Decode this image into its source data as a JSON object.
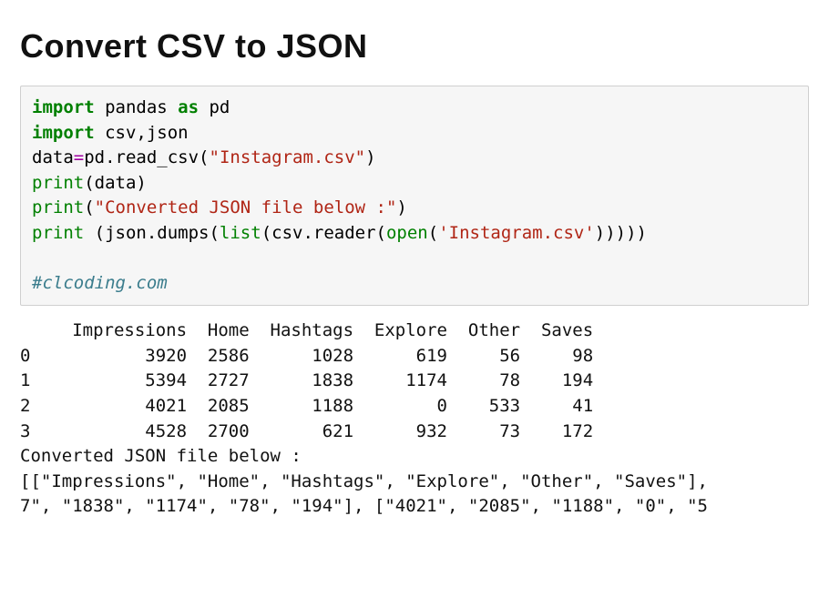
{
  "title": "Convert CSV to JSON",
  "code": {
    "line1": {
      "kw_import1": "import",
      "pandas": " pandas ",
      "kw_as": "as",
      "pd": " pd"
    },
    "line2": {
      "kw_import2": "import",
      "modules": " csv,json"
    },
    "line3": {
      "data": "data",
      "eq": "=",
      "pdread": "pd.read_csv(",
      "file": "\"Instagram.csv\"",
      "close": ")"
    },
    "line4": {
      "print": "print",
      "args": "(data)"
    },
    "line5": {
      "print": "print",
      "open": "(",
      "str": "\"Converted JSON file below :\"",
      "close": ")"
    },
    "line6": {
      "print": "print",
      "space": " (json.dumps(",
      "list": "list",
      "mid": "(csv.reader(",
      "open": "open",
      "paren": "(",
      "file": "'Instagram.csv'",
      "tail": ")))))"
    },
    "blank": "",
    "comment": "#clcoding.com"
  },
  "output": {
    "header": "     Impressions  Home  Hashtags  Explore  Other  Saves",
    "row0": "0           3920  2586      1028      619     56     98",
    "row1": "1           5394  2727      1838     1174     78    194",
    "row2": "2           4021  2085      1188        0    533     41",
    "row3": "3           4528  2700       621      932     73    172",
    "msg": "Converted JSON file below :",
    "json1": "[[\"Impressions\", \"Home\", \"Hashtags\", \"Explore\", \"Other\", \"Saves\"],",
    "json2": "7\", \"1838\", \"1174\", \"78\", \"194\"], [\"4021\", \"2085\", \"1188\", \"0\", \"5"
  },
  "chart_data": {
    "type": "table",
    "title": "Instagram.csv (pandas print)",
    "columns": [
      "Impressions",
      "Home",
      "Hashtags",
      "Explore",
      "Other",
      "Saves"
    ],
    "index": [
      0,
      1,
      2,
      3
    ],
    "rows": [
      [
        3920,
        2586,
        1028,
        619,
        56,
        98
      ],
      [
        5394,
        2727,
        1838,
        1174,
        78,
        194
      ],
      [
        4021,
        2085,
        1188,
        0,
        533,
        41
      ],
      [
        4528,
        2700,
        621,
        932,
        73,
        172
      ]
    ]
  }
}
